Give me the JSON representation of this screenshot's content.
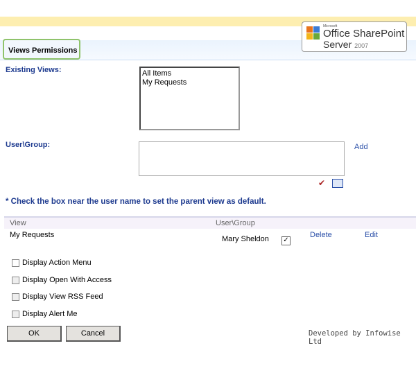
{
  "header": {
    "title": "Views Permissions",
    "logo": {
      "microsoft": "Microsoft",
      "line1": "Office SharePoint",
      "line2": "Server",
      "year": "2007"
    }
  },
  "form": {
    "existing_views_label": "Existing Views:",
    "views": [
      "All Items",
      "My Requests"
    ],
    "user_group_label": "User\\Group:",
    "user_group_value": "",
    "add_label": "Add",
    "note": "* Check the box near the user name to set the parent view as default."
  },
  "table": {
    "columns": [
      "View",
      "User\\Group"
    ],
    "rows": [
      {
        "view": "My Requests",
        "user": "Mary Sheldon",
        "default_checked": true,
        "delete_label": "Delete",
        "edit_label": "Edit"
      }
    ]
  },
  "options": [
    {
      "label": "Display Action Menu",
      "checked": false
    },
    {
      "label": "Display Open With Access",
      "checked": false
    },
    {
      "label": "Display View RSS Feed",
      "checked": false
    },
    {
      "label": "Display Alert Me",
      "checked": false
    }
  ],
  "buttons": {
    "ok": "OK",
    "cancel": "Cancel"
  },
  "footer": "Developed by Infowise Ltd"
}
